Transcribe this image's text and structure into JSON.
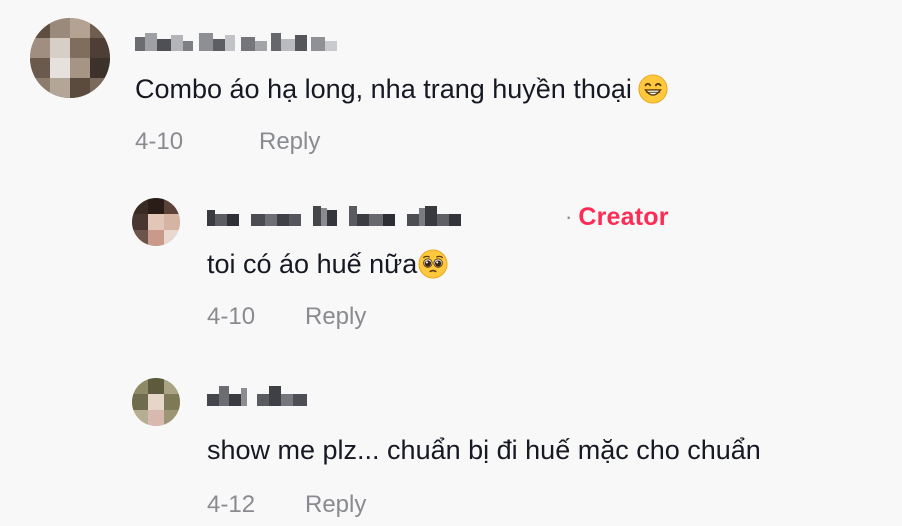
{
  "comments": [
    {
      "author": "M... ... ...",
      "is_creator": false,
      "text": "Combo áo hạ long, nha trang huyền thoại",
      "emoji": "grinning-face-emoji",
      "date": "4-10",
      "reply_label": "Reply"
    },
    {
      "author": "tóc mọc kít làm video",
      "separator": "·",
      "creator_label": "Creator",
      "is_creator": true,
      "text": "toi có áo huế nữa",
      "emoji": "pleading-face-emoji",
      "date": "4-10",
      "reply_label": "Reply"
    },
    {
      "author": "chi chu",
      "is_creator": false,
      "text": "show me plz... chuẩn bị đi huế mặc cho chuẩn",
      "date": "4-12",
      "reply_label": "Reply"
    }
  ],
  "colors": {
    "background": "#f8f8f8",
    "text": "#161823",
    "meta": "#8a8b91",
    "creator": "#fe2c55"
  }
}
